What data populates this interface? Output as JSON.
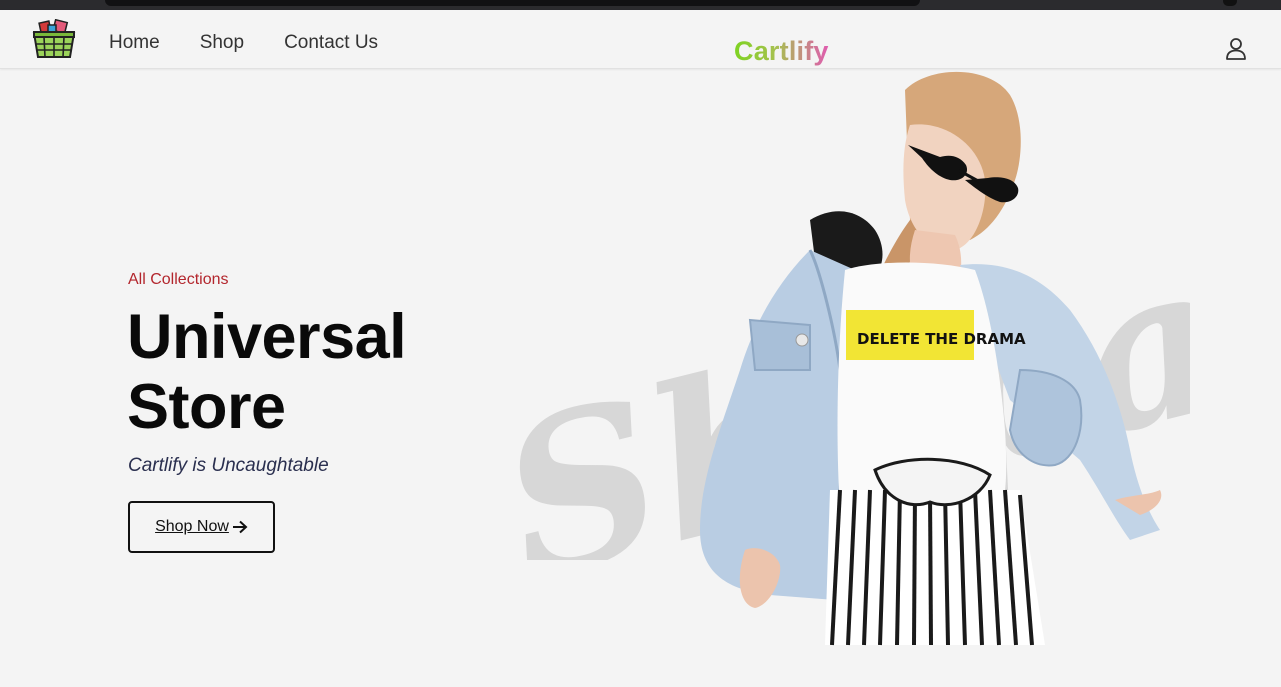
{
  "navbar": {
    "links": [
      {
        "label": "Home"
      },
      {
        "label": "Shop"
      },
      {
        "label": "Contact Us"
      }
    ],
    "brand": {
      "text": "Cartlify",
      "gradient_colors": [
        "#7ed321",
        "#e05bb0"
      ]
    },
    "icons": {
      "logo": "shopping-basket-icon",
      "account": "user-icon"
    }
  },
  "hero": {
    "eyebrow": "All Collections",
    "title_line1": "Universal",
    "title_line2": "Store",
    "tagline": "Cartlify is Uncaughtable",
    "cta_label": "Shop Now ",
    "cta_icon": "arrow-right-icon",
    "shirt_text": "DELETE THE DRAMA",
    "watermark_text": "Shopaholic"
  },
  "colors": {
    "background": "#f4f4f4",
    "accent_red": "#b3262d",
    "title": "#0a0a0a",
    "tagline": "#2a2f4f"
  }
}
